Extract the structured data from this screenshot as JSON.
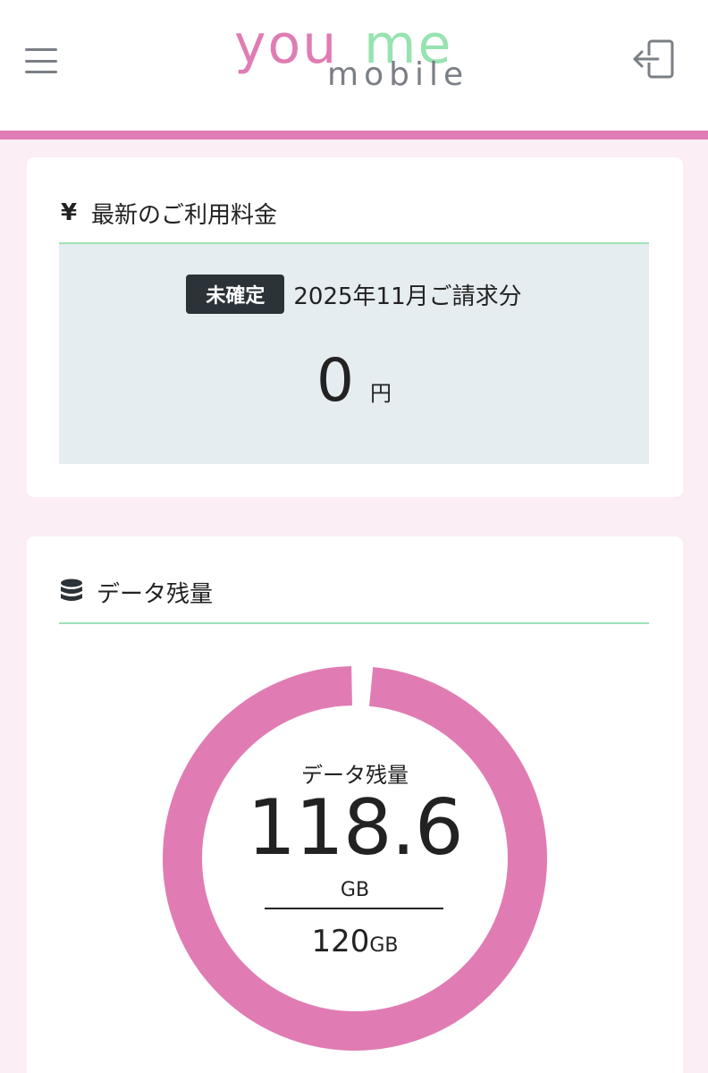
{
  "header": {
    "logo": {
      "part1": "you",
      "part2": "me",
      "sub": "mobile"
    },
    "menu_icon": "hamburger-icon",
    "logout_icon": "logout-icon"
  },
  "colors": {
    "brand_pink": "#e07cb3",
    "brand_green": "#97e3b0",
    "background": "#fbeef4"
  },
  "billing": {
    "title": "最新のご利用料金",
    "icon": "yen-icon",
    "icon_glyph": "¥",
    "status_badge": "未確定",
    "period": "2025年11月ご請求分",
    "amount": "0",
    "unit": "円"
  },
  "data_usage": {
    "title": "データ残量",
    "icon": "database-icon",
    "center_label": "データ残量",
    "remaining": "118.6",
    "remaining_unit": "GB",
    "total": "120",
    "total_unit": "GB",
    "remaining_value": 118.6,
    "total_value": 120
  }
}
